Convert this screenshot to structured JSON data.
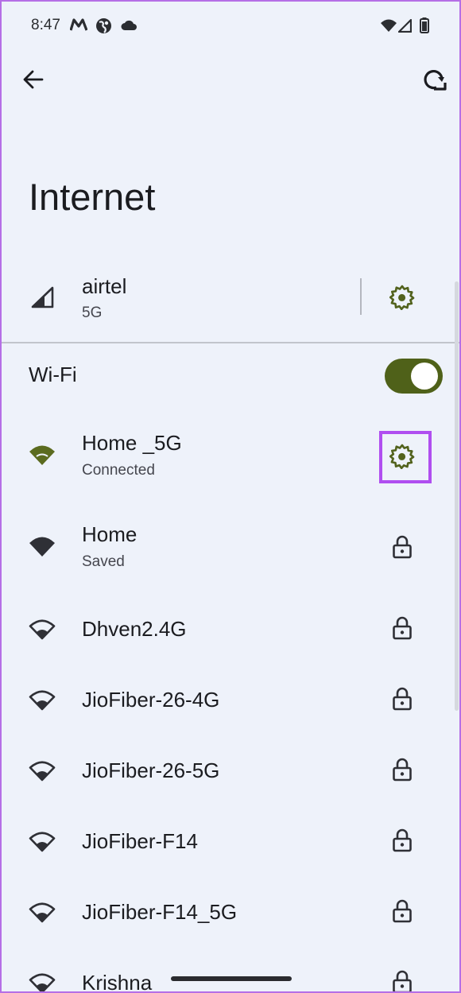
{
  "status_bar": {
    "time": "8:47",
    "icons": [
      "app-m-icon",
      "app-globe-icon",
      "cloud-icon",
      "wifi-icon",
      "signal-icon",
      "battery-icon"
    ]
  },
  "top_bar": {
    "back_icon": "arrow-left-icon",
    "action_icon": "refresh-network-icon"
  },
  "page": {
    "title": "Internet"
  },
  "mobile_network": {
    "name": "airtel",
    "subtitle": "5G",
    "icon": "cell-signal-icon",
    "trailing_icon": "gear-icon"
  },
  "wifi": {
    "label": "Wi-Fi",
    "enabled": true
  },
  "networks": [
    {
      "name": "Home _5G",
      "status": "Connected",
      "icon": "wifi-full-icon",
      "trailing": "gear-icon"
    },
    {
      "name": "Home",
      "status": "Saved",
      "icon": "wifi-full-icon",
      "trailing": "lock-icon"
    },
    {
      "name": "Dhven2.4G",
      "status": "",
      "icon": "wifi-outline-icon",
      "trailing": "lock-icon"
    },
    {
      "name": "JioFiber-26-4G",
      "status": "",
      "icon": "wifi-outline-icon",
      "trailing": "lock-icon"
    },
    {
      "name": "JioFiber-26-5G",
      "status": "",
      "icon": "wifi-outline-icon",
      "trailing": "lock-icon"
    },
    {
      "name": "JioFiber-F14",
      "status": "",
      "icon": "wifi-outline-icon",
      "trailing": "lock-icon"
    },
    {
      "name": "JioFiber-F14_5G",
      "status": "",
      "icon": "wifi-outline-icon",
      "trailing": "lock-icon"
    },
    {
      "name": "Krishna",
      "status": "",
      "icon": "wifi-outline-icon",
      "trailing": "lock-icon"
    }
  ],
  "colors": {
    "accent": "#5b6b1f",
    "toggle_track": "#4f6119",
    "highlight": "#b04ef0",
    "background": "#eef2fa"
  }
}
